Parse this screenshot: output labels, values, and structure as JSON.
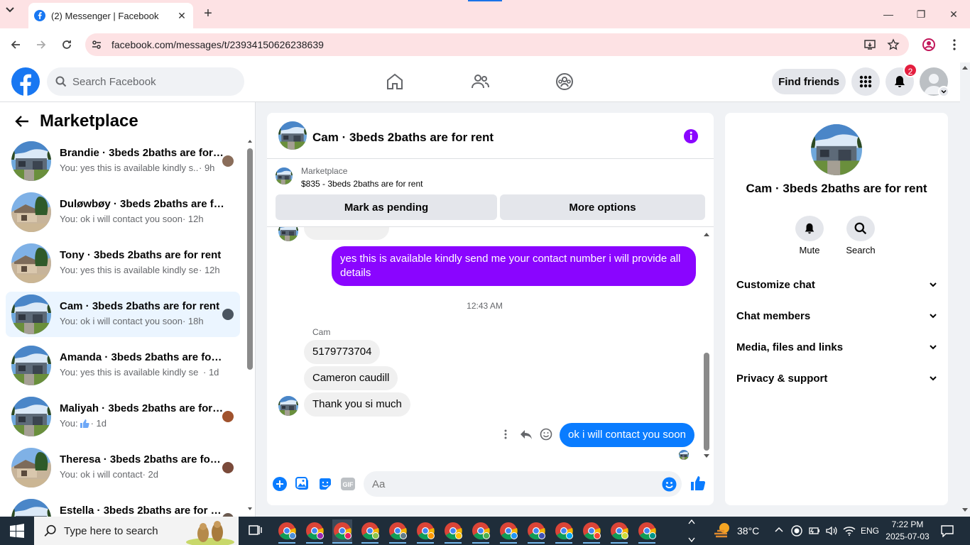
{
  "browser": {
    "tab_title": "(2) Messenger | Facebook",
    "url": "facebook.com/messages/t/23934150626238639"
  },
  "fb": {
    "search_placeholder": "Search Facebook",
    "find_friends": "Find friends",
    "notif_count": "2"
  },
  "sidebar": {
    "title": "Marketplace",
    "chats": [
      {
        "name": "Brandie · 3beds 2baths are for rent",
        "preview": "You: yes this is available kindly s...",
        "time": "· 9h"
      },
      {
        "name": "Duløwbøy · 3beds 2baths are for rent",
        "preview": "You: ok i will contact you soon",
        "time": "· 12h"
      },
      {
        "name": "Tony · 3beds 2baths are for rent",
        "preview": "You: yes this is available kindly sen...",
        "time": "· 12h"
      },
      {
        "name": "Cam · 3beds 2baths are for rent",
        "preview": "You: ok i will contact you soon",
        "time": "· 18h"
      },
      {
        "name": "Amanda · 3beds 2baths are for rent",
        "preview": "You: yes this is available kindly sen...",
        "time": "· 1d"
      },
      {
        "name": "Maliyah · 3beds 2baths are for rent",
        "preview": "You:",
        "time": "· 1d"
      },
      {
        "name": "Theresa · 3beds 2baths are for rent",
        "preview": "You: ok i will contact",
        "time": "· 2d"
      },
      {
        "name": "Estella · 3beds 2baths are for rent",
        "preview": "",
        "time": ""
      }
    ]
  },
  "conversation": {
    "title": "Cam · 3beds 2baths are for rent",
    "marketplace_label": "Marketplace",
    "listing": "$835 - 3beds 2baths are for rent",
    "mark_pending": "Mark as pending",
    "more_options": "More options",
    "messages": {
      "out1": "yes this is available kindly send me your contact number i will provide all details",
      "timestamp": "12:43 AM",
      "sender": "Cam",
      "in1": "5179773704",
      "in2": "Cameron caudill",
      "in3": "Thank you si much",
      "out2": "ok i will contact you soon"
    },
    "composer_placeholder": "Aa"
  },
  "info": {
    "name": "Cam · 3beds 2baths are for rent",
    "mute": "Mute",
    "search": "Search",
    "sections": [
      "Customize chat",
      "Chat members",
      "Media, files and links",
      "Privacy & support"
    ]
  },
  "taskbar": {
    "search_placeholder": "Type here to search",
    "temp": "38°C",
    "lang": "ENG",
    "time": "7:22 PM",
    "date": "2025-07-03"
  },
  "colors": {
    "fb_blue": "#1877f2",
    "purple_bubble": "#8a05ff",
    "blue_bubble": "#0a7cff",
    "chrome_pink": "#fde2e4"
  }
}
